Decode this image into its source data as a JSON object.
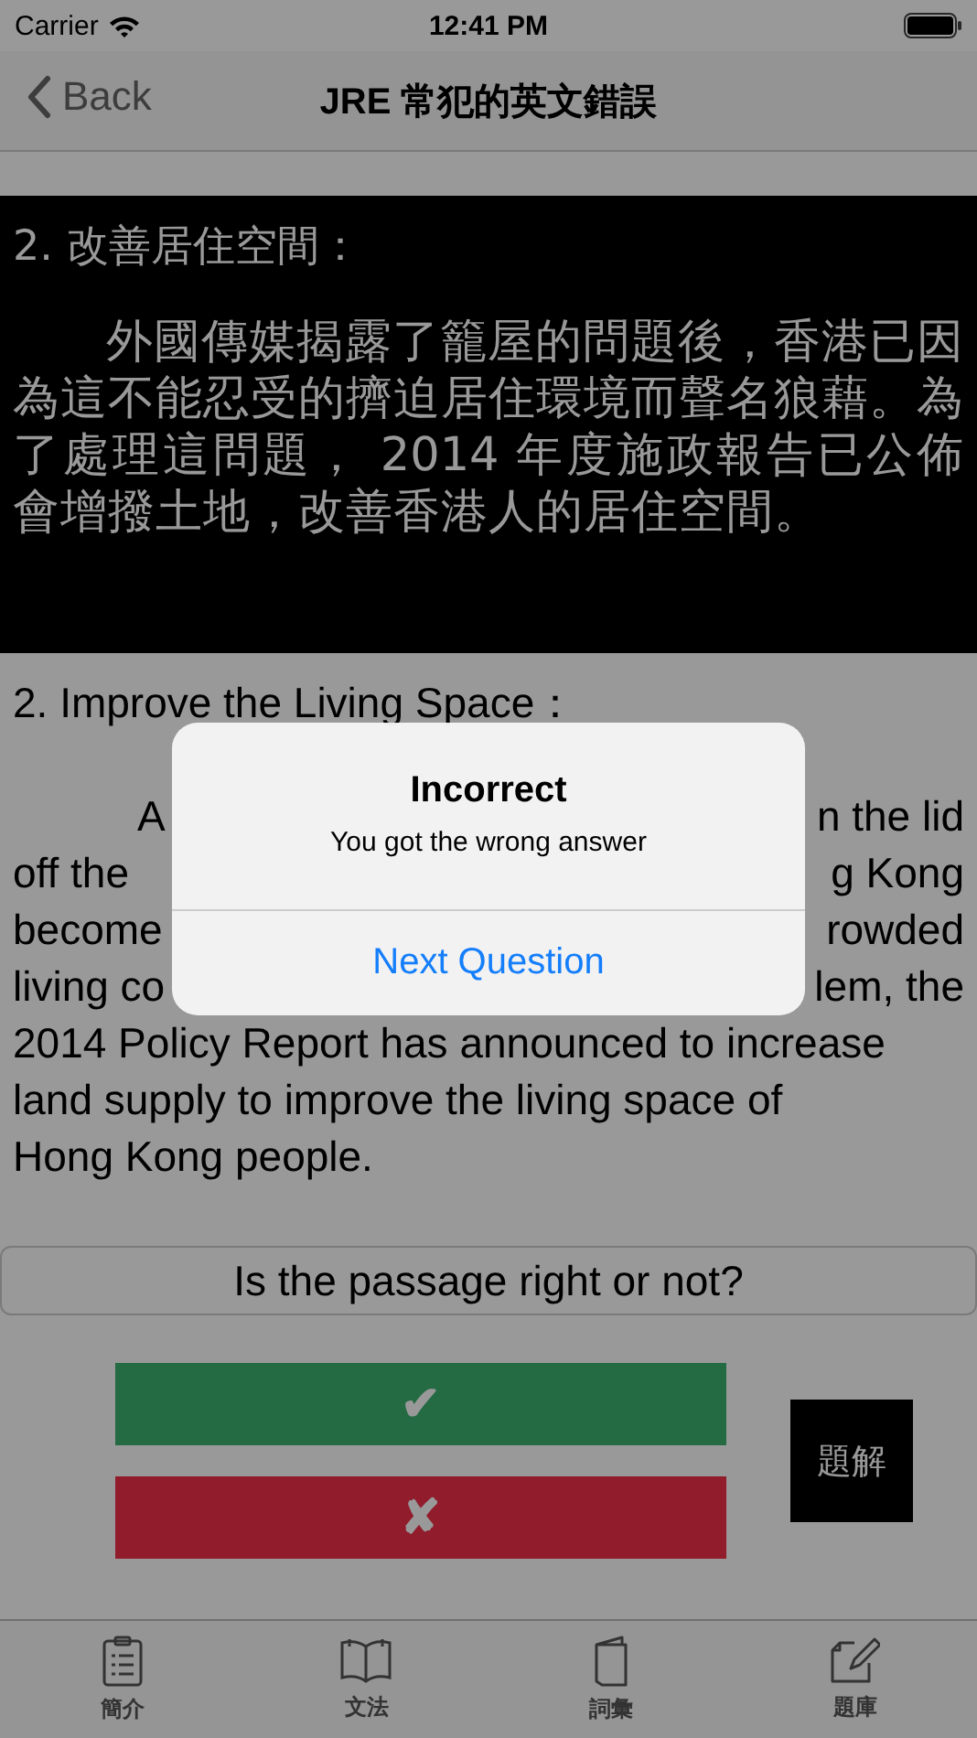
{
  "status_bar": {
    "carrier": "Carrier",
    "time": "12:41 PM"
  },
  "nav": {
    "back": "Back",
    "title": "JRE 常犯的英文錯誤"
  },
  "chinese": {
    "heading": "2. 改善居住空間：",
    "body": "外國傳媒揭露了籠屋的問題後，香港已因為這不能忍受的擠迫居住環境而聲名狼藉。為了處理這問題， 2014 年度施政報告已公佈會增撥土地，改善香港人的居住空間。"
  },
  "english": {
    "heading": "2. Improve the Living Space：",
    "partial_lines": [
      {
        "left": "A",
        "right": "n the lid"
      },
      {
        "left": "off  the",
        "right": "g Kong"
      },
      {
        "left": "become",
        "right": "rowded"
      },
      {
        "left": "living co",
        "right": "lem, the"
      }
    ],
    "lines": [
      "2014 Policy Report has announced to increase",
      "land supply to improve the living space of",
      "Hong Kong people."
    ]
  },
  "question": "Is the passage right or not?",
  "answers": [
    {
      "kind": "right",
      "label": "✔"
    },
    {
      "kind": "wrong",
      "label": "✘"
    }
  ],
  "explain_button": "題解",
  "tabs": [
    {
      "kind": "clipboard",
      "label": "簡介"
    },
    {
      "kind": "book",
      "label": "文法"
    },
    {
      "kind": "notebook",
      "label": "詞彙"
    },
    {
      "kind": "edit",
      "label": "題庫"
    }
  ],
  "alert": {
    "title": "Incorrect",
    "message": "You got the wrong answer",
    "action": "Next Question"
  }
}
